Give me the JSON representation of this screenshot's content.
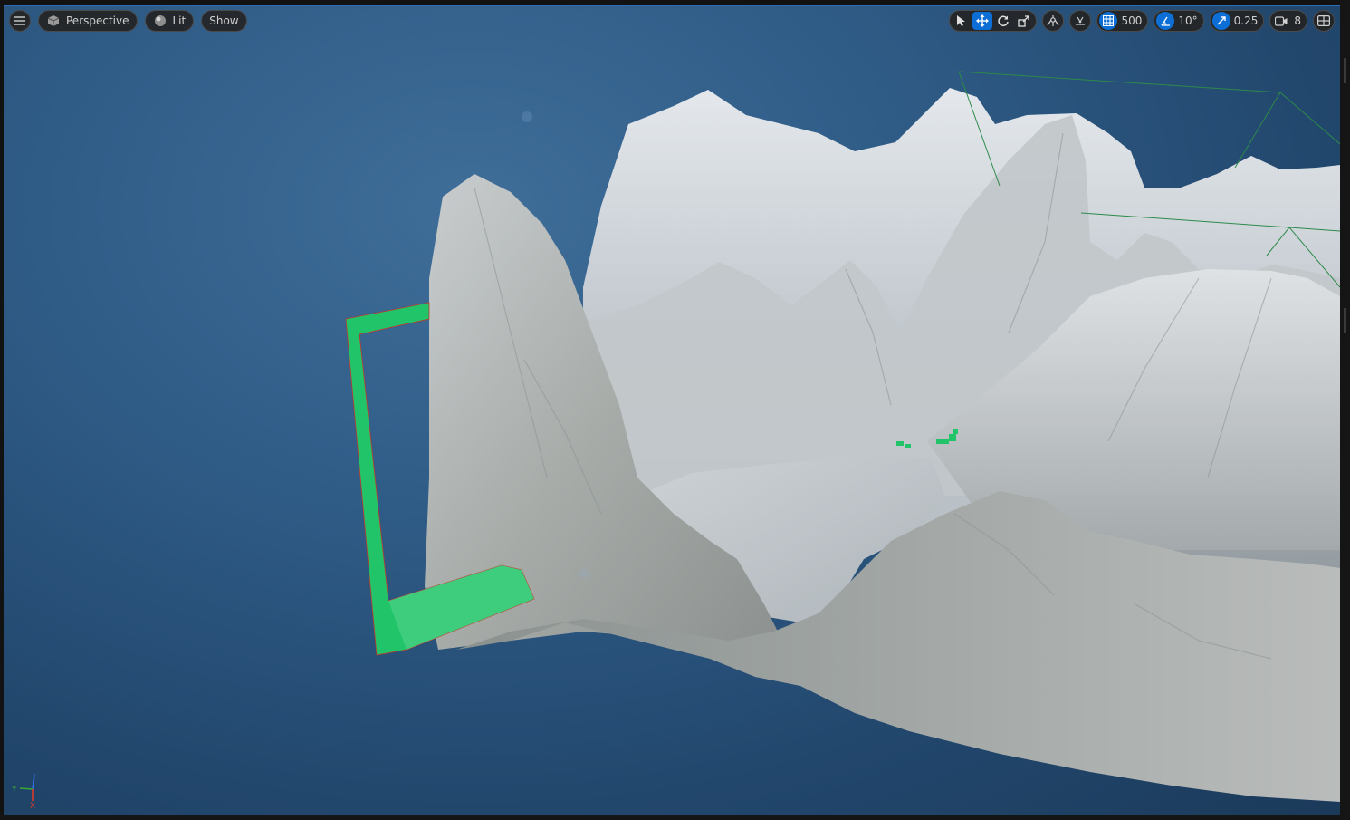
{
  "toolbar": {
    "view_mode_label": "Perspective",
    "lighting_label": "Lit",
    "show_label": "Show",
    "grid_snap_value": "500",
    "rotation_snap_value": "10°",
    "scale_snap_value": "0.25",
    "camera_speed_value": "8"
  },
  "axis": {
    "x_label": "X",
    "y_label": "Y"
  },
  "colors": {
    "accent": "#0d6fd6",
    "selection_green": "#22c46a"
  }
}
